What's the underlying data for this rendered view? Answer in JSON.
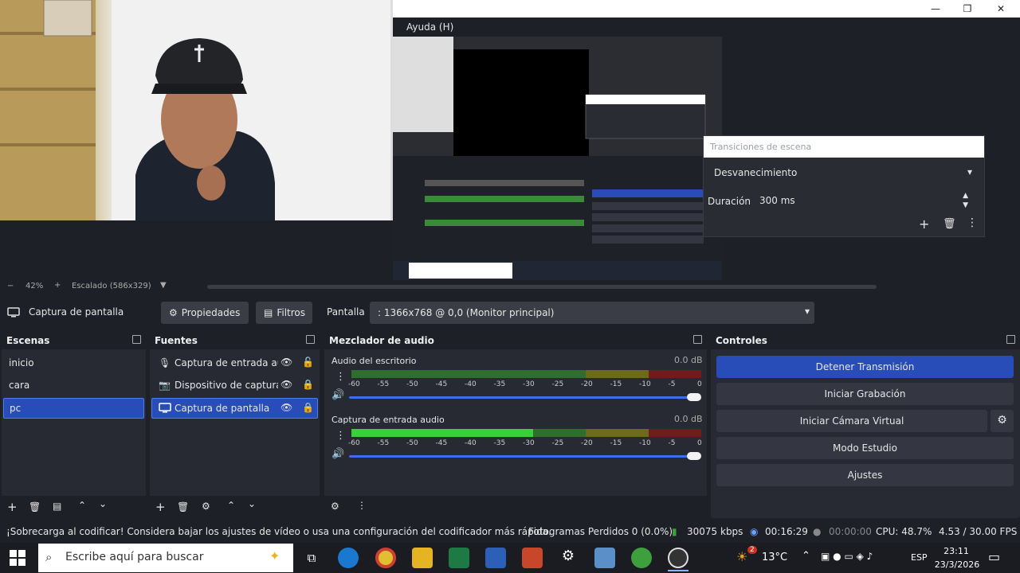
{
  "menu": {
    "help": "Ayuda (H)"
  },
  "transition_panel": {
    "title": "Transiciones de escena",
    "type": "Desvanecimiento",
    "duration_label": "Duración",
    "duration_value": "300 ms"
  },
  "zoom": {
    "minus": "−",
    "percent": "42%",
    "plus": "+",
    "scale": "Escalado (586x329)"
  },
  "source_toolbar": {
    "source_name": "Captura de pantalla",
    "properties": "Propiedades",
    "filters": "Filtros",
    "screen_label": "Pantalla",
    "screen_value": ": 1366x768 @ 0,0 (Monitor principal)"
  },
  "scenes": {
    "title": "Escenas",
    "items": [
      "inicio",
      "cara",
      "pc"
    ],
    "selected": "pc"
  },
  "sources": {
    "title": "Fuentes",
    "items": [
      {
        "label": "Captura de entrada auc",
        "icon": "microphone-icon"
      },
      {
        "label": "Dispositivo de captura",
        "icon": "camera-icon"
      },
      {
        "label": "Captura de pantalla",
        "icon": "monitor-icon"
      }
    ]
  },
  "mixer": {
    "title": "Mezclador de audio",
    "tracks": [
      {
        "name": "Audio del escritorio",
        "db": "0.0 dB",
        "level": 0.0
      },
      {
        "name": "Captura de entrada audio",
        "db": "0.0 dB",
        "level": 0.52
      }
    ],
    "ticks": [
      "-60",
      "-55",
      "-50",
      "-45",
      "-40",
      "-35",
      "-30",
      "-25",
      "-20",
      "-15",
      "-10",
      "-5",
      "0"
    ]
  },
  "controls": {
    "title": "Controles",
    "buttons": [
      "Detener Transmisión",
      "Iniciar Grabación",
      "Iniciar Cámara Virtual",
      "Modo Estudio",
      "Ajustes"
    ]
  },
  "status": {
    "warning": "¡Sobrecarga al codificar! Considera bajar los ajustes de vídeo o usa una configuración del codificador más rápida.",
    "dropped": "Fotogramas Perdidos 0 (0.0%)",
    "bitrate": "30075 kbps",
    "stream_time": "00:16:29",
    "rec_time": "00:00:00",
    "cpu": "CPU: 48.7%",
    "fps": "4.53 / 30.00 FPS"
  },
  "taskbar": {
    "search_placeholder": "Escribe aquí para buscar",
    "temperature": "13°C",
    "language": "ESP",
    "time": "23:11",
    "date": "23/3/2026",
    "weather_badge": "2"
  },
  "colors": {
    "accent": "#284cb8",
    "panel": "#272a33",
    "bg": "#1e2027",
    "meter_green": "#3da03d",
    "meter_yellow": "#8a8a1e",
    "meter_red": "#8a1e1e"
  }
}
